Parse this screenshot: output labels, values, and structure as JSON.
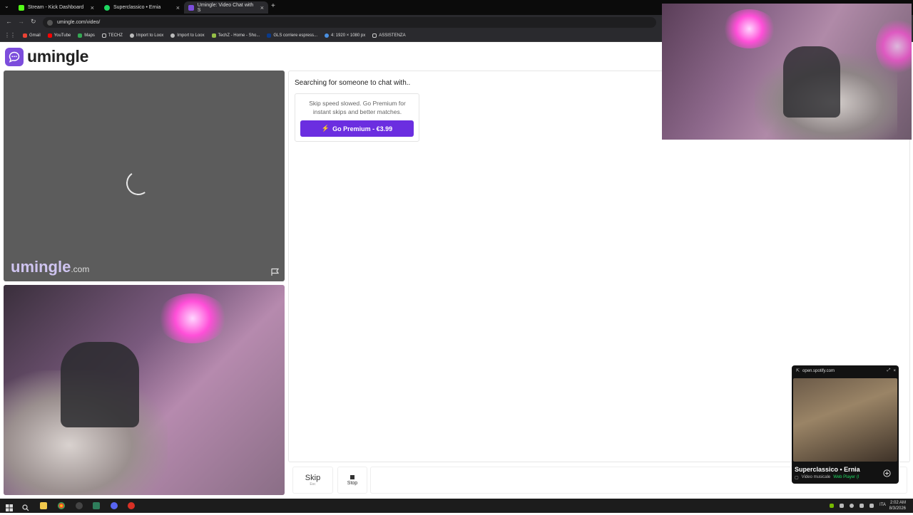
{
  "browser": {
    "tabs": [
      {
        "label": "Stream - Kick Dashboard",
        "color": "#53fc18"
      },
      {
        "label": "Superclassico • Ernia",
        "color": "#1ed760"
      },
      {
        "label": "Umingle: Video Chat with S",
        "color": "#7c4ddc"
      }
    ],
    "url": "umingle.com/video/",
    "bookmarks": [
      {
        "label": "Gmail",
        "color": "#ea4335"
      },
      {
        "label": "YouTube",
        "color": "#ff0000"
      },
      {
        "label": "Maps",
        "color": "#34a853"
      },
      {
        "label": "TECHZ",
        "color": "#cccccc"
      },
      {
        "label": "Import to Loox",
        "color": "#bbbbbb"
      },
      {
        "label": "Import to Loox",
        "color": "#bbbbbb"
      },
      {
        "label": "TechZ - Home - Sho...",
        "color": "#95bf47"
      },
      {
        "label": "GLS corriere espress...",
        "color": "#0a3a8a"
      },
      {
        "label": "4: 1920 × 1080 px",
        "color": "#4a90e2"
      },
      {
        "label": "ASSISTENZA",
        "color": "#cccccc"
      }
    ]
  },
  "site": {
    "logo": "umingle",
    "watermark_main": "umingle",
    "watermark_suffix": ".com"
  },
  "chat": {
    "status": "Searching for someone to chat with..",
    "premium_note": "Skip speed slowed. Go Premium for instant skips and better matches.",
    "premium_button": "Go Premium - €3.99",
    "skip_label": "Skip",
    "skip_key": "Esc",
    "stop_label": "Stop"
  },
  "spotify": {
    "source": "open.spotify.com",
    "title": "Superclassico • Ernia",
    "subtitle": "Video musicale",
    "player": "Web Player (I"
  },
  "taskbar": {
    "lang": "ITA",
    "time": "2:02 AM",
    "date": "8/3/2026"
  },
  "colors": {
    "brand": "#7c4ddc",
    "premium": "#6b2ee0"
  }
}
